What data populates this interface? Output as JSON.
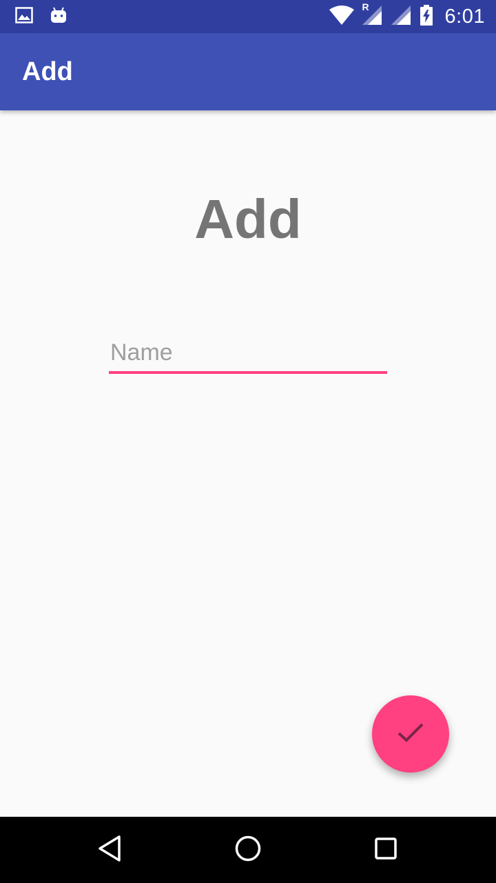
{
  "status_bar": {
    "time": "6:01",
    "left_icons": [
      "image-icon",
      "android-icon"
    ],
    "right_icons": [
      "wifi-icon",
      "signal-roaming-icon",
      "signal-icon",
      "battery-charging-icon"
    ],
    "roaming_label": "R"
  },
  "toolbar": {
    "title": "Add",
    "color": "#3f51b5"
  },
  "main": {
    "heading": "Add",
    "name_input": {
      "placeholder": "Name",
      "value": ""
    },
    "fab_icon": "check-icon",
    "accent_color": "#ff4081"
  },
  "nav_bar": {
    "buttons": [
      "back-icon",
      "home-icon",
      "recents-icon"
    ]
  }
}
